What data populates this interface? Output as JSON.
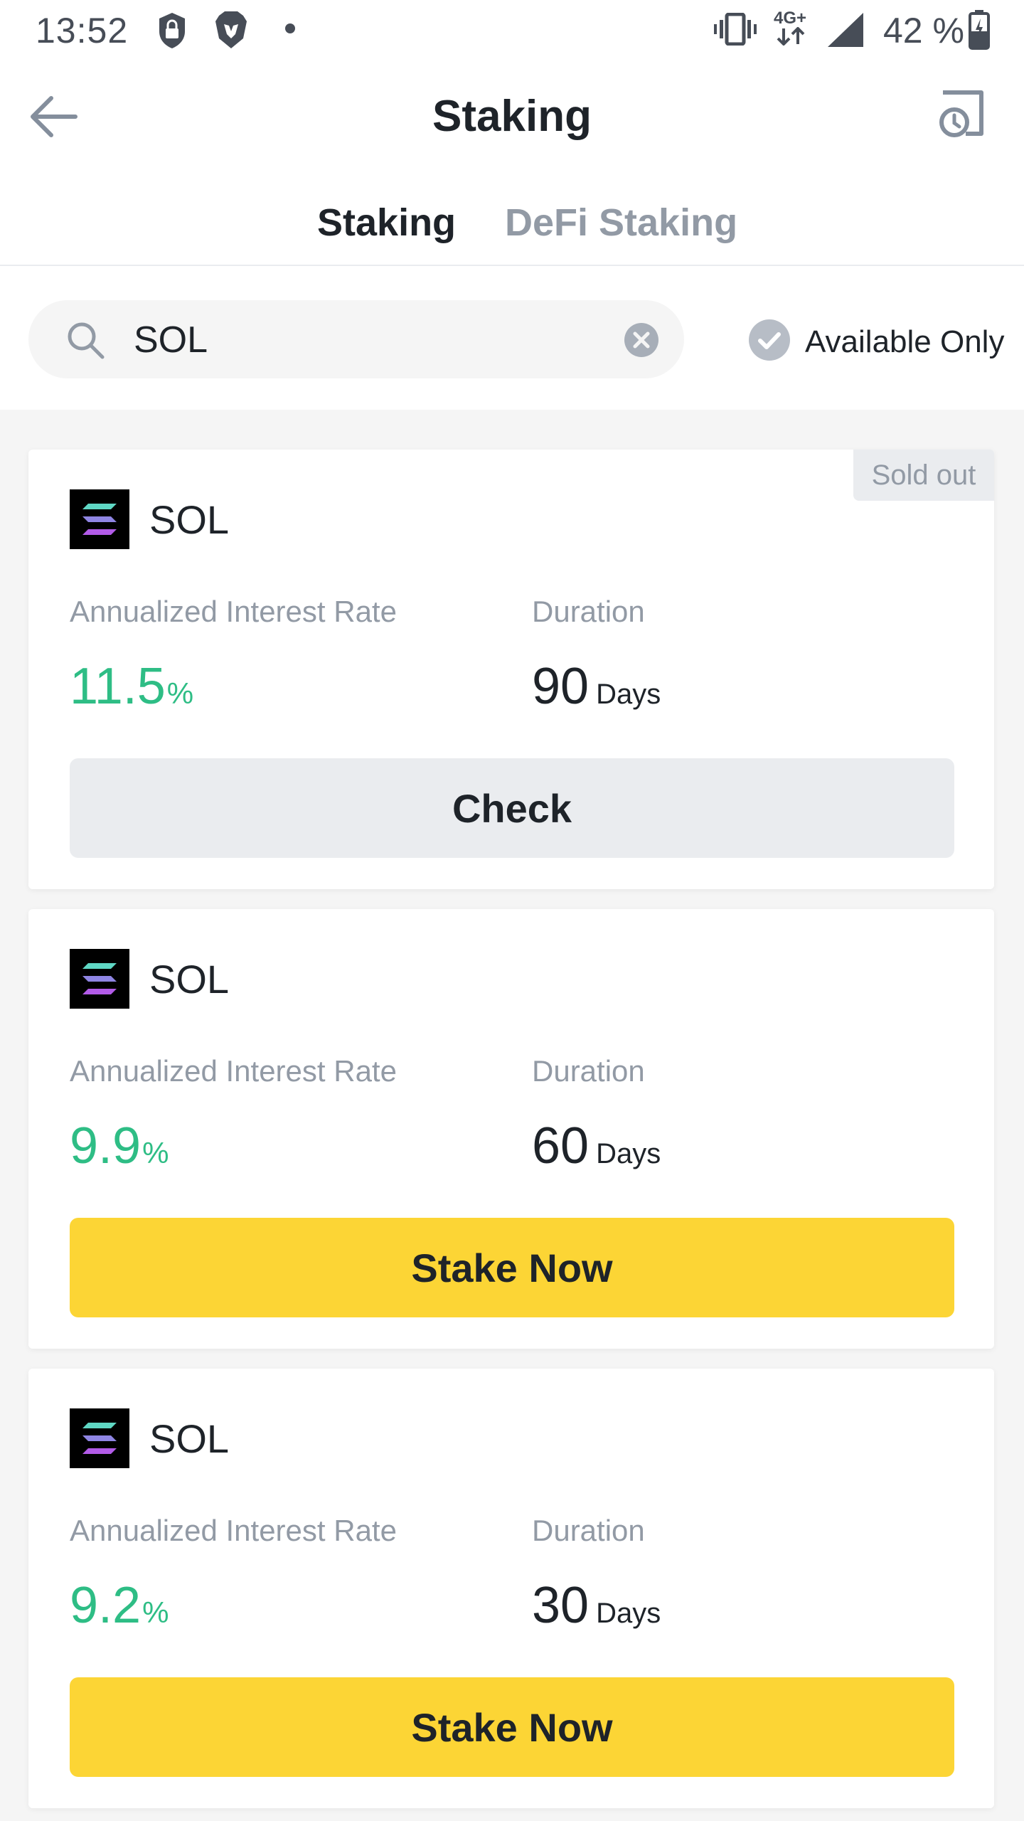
{
  "status_bar": {
    "time": "13:52",
    "network": "4G+",
    "battery": "42 %"
  },
  "header": {
    "title": "Staking"
  },
  "tabs": [
    {
      "label": "Staking",
      "active": true
    },
    {
      "label": "DeFi Staking",
      "active": false
    }
  ],
  "search": {
    "value": "SOL"
  },
  "filter": {
    "label": "Available Only",
    "checked": true
  },
  "colors": {
    "accent": "#fcd535",
    "positive": "#2ebd85",
    "underline": "#f0b90b"
  },
  "products": [
    {
      "coin": "SOL",
      "badge": "Sold out",
      "rate_label": "Annualized Interest Rate",
      "rate": "11.5",
      "rate_unit": "%",
      "duration_label": "Duration",
      "duration": "90",
      "duration_unit": "Days",
      "action": "Check"
    },
    {
      "coin": "SOL",
      "badge": "",
      "rate_label": "Annualized Interest Rate",
      "rate": "9.9",
      "rate_unit": "%",
      "duration_label": "Duration",
      "duration": "60",
      "duration_unit": "Days",
      "action": "Stake Now"
    },
    {
      "coin": "SOL",
      "badge": "",
      "rate_label": "Annualized Interest Rate",
      "rate": "9.2",
      "rate_unit": "%",
      "duration_label": "Duration",
      "duration": "30",
      "duration_unit": "Days",
      "action": "Stake Now"
    }
  ]
}
